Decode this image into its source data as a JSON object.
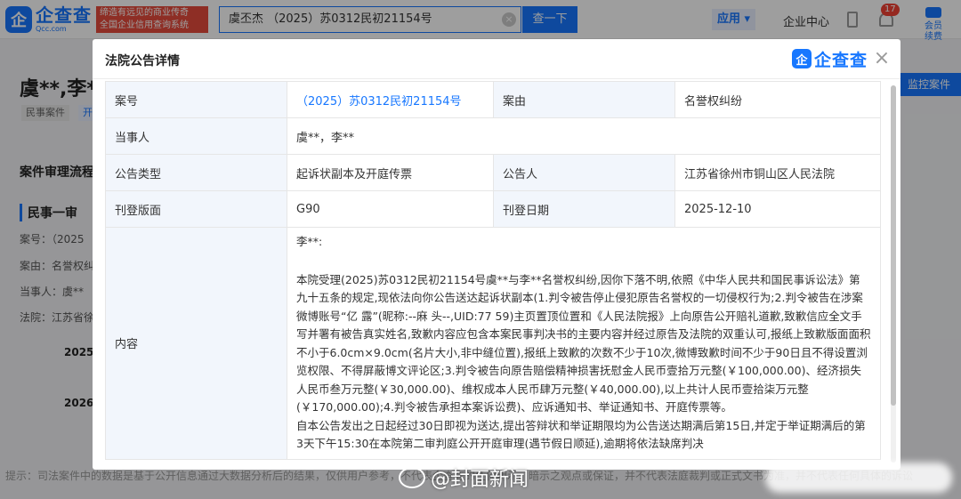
{
  "topbar": {
    "logo_mark": "企",
    "logo_name": "企查查",
    "logo_domain": "Qcc.com",
    "slogan_line1": "缔造有远见的商业传奇",
    "slogan_line2": "全国企业信用查询系统",
    "search_value": "虞丕杰 （2025）苏0312民初21154号",
    "search_button": "查一下",
    "nav_app": "应用 ▾",
    "nav_center": "企业中心",
    "notification_count": "17",
    "vip_label_1": "会员",
    "vip_label_2": "续费"
  },
  "background": {
    "title": "虞**,李**",
    "tag1": "民事案件",
    "tag2": "开",
    "section": "案件审理流程",
    "sub": "民事一审",
    "lines": [
      "案号：（2025",
      "案由：名誉权纠",
      "当事人：虞**",
      "法院：江苏省徐"
    ],
    "years": [
      "2025",
      "2026"
    ],
    "tip": "提示：司法案件中的数据是基于公开信息通过大数据分析后的结果，仅供用户参考，不代表企查查的任何明示、暗示之观点或保证，并不代表法庭裁判或正式文书为准，并不代表任何具体的诉讼",
    "monitor_button": "监控案件"
  },
  "modal": {
    "title": "法院公告详情",
    "logo_mark": "企",
    "logo_name": "企查查",
    "close": "×",
    "rows": {
      "case_no_label": "案号",
      "case_no": "（2025）苏0312民初21154号",
      "cause_label": "案由",
      "cause": "名誉权纠纷",
      "party_label": "当事人",
      "party": "虞**，李**",
      "type_label": "公告类型",
      "type": "起诉状副本及开庭传票",
      "announcer_label": "公告人",
      "announcer": "江苏省徐州市铜山区人民法院",
      "page_label": "刊登版面",
      "page": "G90",
      "date_label": "刊登日期",
      "date": "2025-12-10",
      "content_label": "内容",
      "content_addressee": "李**:",
      "content_para1": "本院受理(2025)苏0312民初21154号虞**与李**名誉权纠纷,因你下落不明,依照《中华人民共和国民事诉讼法》第九十五条的规定,现依法向你公告送达起诉状副本(1.判令被告停止侵犯原告名誉权的一切侵权行为;2.判令被告在涉案微博账号“亿      露”(昵称:--麻        头--,UID:77          59)主页置顶位置和《人民法院报》上向原告公开赔礼道歉,致歉信应全文手写并署有被告真实姓名,致歉内容应包含本案民事判决书的主要内容并经过原告及法院的双重认可,报纸上致歉版面面积不小于6.0cm×9.0cm(名片大小,非中缝位置),报纸上致歉的次数不少于10次,微博致歉时间不少于90日且不得设置浏览权限、不得屏蔽博文评论区;3.判令被告向原告赔偿精神损害抚慰金人民币壹拾万元整(￥100,000.00)、经济损失人民币叁万元整(￥30,000.00)、维权成本人民币肆万元整(￥40,000.00),以上共计人民币壹拾柒万元整(￥170,000.00);4.判令被告承担本案诉讼费)、应诉通知书、举证通知书、开庭传票等。",
      "content_para2": "自本公告发出之日起经过30日即视为送达,提出答辩状和举证期限均为公告送达期满后第15日,并定于举证期满后的第3天下午15:30在本院第二审判庭公开开庭审理(遇节假日顺延),逾期将依法缺席判决"
    }
  },
  "watermark": "@封面新闻"
}
